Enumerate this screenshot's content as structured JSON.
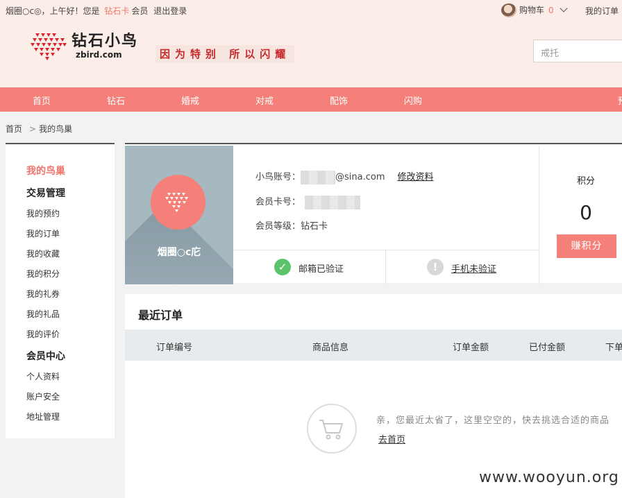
{
  "topbar": {
    "username": "烟圈○c◎",
    "greeting": "，上午好！您是",
    "member_card": "钻石卡",
    "member_word": "会员",
    "logout": "退出登录",
    "cart_label": "购物车",
    "cart_count": "0",
    "my_account": "我的订单"
  },
  "header": {
    "logo_cn": "钻石小鸟",
    "logo_en": "zbird.com",
    "slogan": "因为特别 所以闪耀",
    "search_placeholder": "戒托"
  },
  "nav": {
    "items": [
      "首页",
      "钻石",
      "婚戒",
      "对戒",
      "配饰",
      "闪购"
    ],
    "tail": "预"
  },
  "breadcrumb": {
    "home": "首页",
    "separator": ">",
    "current": "我的鸟巢"
  },
  "sidebar": {
    "title": "我的鸟巢",
    "group1": "交易管理",
    "items1": [
      "我的预约",
      "我的订单",
      "我的收藏",
      "我的积分",
      "我的礼券",
      "我的礼品",
      "我的评价"
    ],
    "group2": "会员中心",
    "items2": [
      "个人资料",
      "账户安全",
      "地址管理"
    ]
  },
  "profile": {
    "avatar_name": "烟圈○c庀",
    "account_label": "小鸟账号：",
    "account_suffix": "@sina.com",
    "edit_link": "修改资料",
    "card_label": "会员卡号：",
    "level_label": "会员等级：",
    "level_value": "钻石卡",
    "email_status": "邮箱已验证",
    "phone_status": "手机未验证",
    "points_label": "积分",
    "points_value": "0",
    "earn_button": "赚积分"
  },
  "orders": {
    "title": "最近订单",
    "columns": [
      "订单编号",
      "商品信息",
      "订单金额",
      "已付金额",
      "下单"
    ],
    "empty_message": "亲，您最近太省了，这里空空的，快去挑选合适的商品",
    "empty_link": "去首页"
  },
  "watermark": "www.wooyun.org",
  "colors": {
    "accent": "#f48079",
    "header_bg": "#fbeee9",
    "slogan": "#c7282a"
  }
}
